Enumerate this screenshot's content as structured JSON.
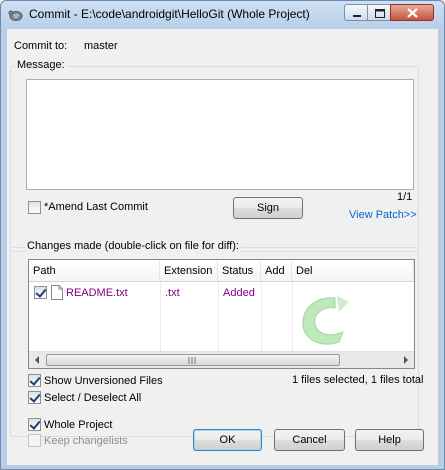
{
  "window": {
    "title": "Commit - E:\\code\\androidgit\\HelloGit (Whole Project)"
  },
  "commit": {
    "to_label": "Commit to:",
    "branch": "master"
  },
  "message": {
    "group_label": "Message:",
    "value": "",
    "amend_label": "*Amend Last Commit",
    "amend_checked": false,
    "counter": "1/1",
    "sign_label": "Sign",
    "view_patch_label": "View Patch>>"
  },
  "changes": {
    "group_label": "Changes made (double-click on file for diff):",
    "columns": [
      "Path",
      "Extension",
      "Status",
      "Add",
      "Del"
    ],
    "rows": [
      {
        "checked": true,
        "path": "README.txt",
        "extension": ".txt",
        "status": "Added",
        "add": "",
        "del": ""
      }
    ],
    "show_unversioned_label": "Show Unversioned Files",
    "select_all_label": "Select / Deselect All",
    "summary": "1 files selected, 1 files total"
  },
  "footer": {
    "whole_project_label": "Whole Project",
    "keep_changelists_label": "Keep changelists",
    "ok_label": "OK",
    "cancel_label": "Cancel",
    "help_label": "Help"
  },
  "colors": {
    "link": "#0066cc",
    "file_text": "#800080",
    "watermark": "#8fd68a"
  },
  "icons": [
    "tortoise-app-icon",
    "minimize-icon",
    "maximize-icon",
    "close-icon",
    "file-icon",
    "scroll-left-icon",
    "scroll-right-icon",
    "tortoisegit-watermark-icon"
  ]
}
